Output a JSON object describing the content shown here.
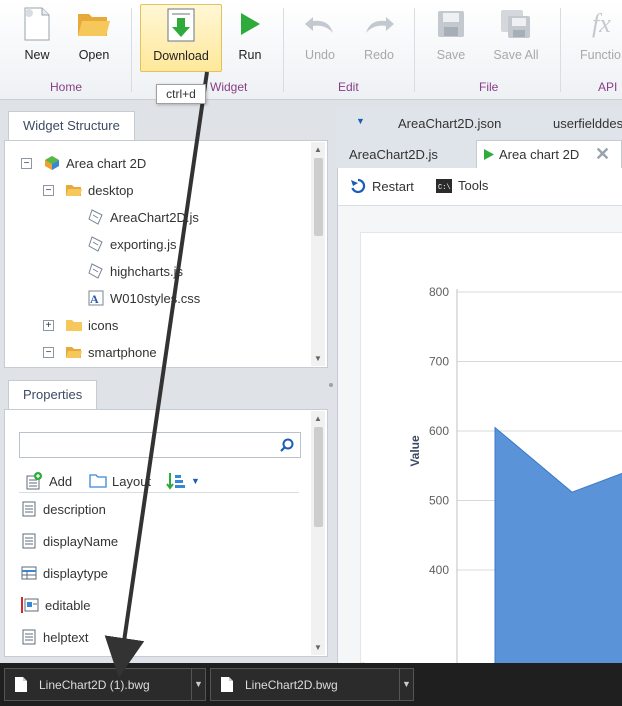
{
  "ribbon": {
    "buttons": {
      "new": "New",
      "open": "Open",
      "download": "Download",
      "run": "Run",
      "undo": "Undo",
      "redo": "Redo",
      "save": "Save",
      "save_all": "Save All",
      "functions": "Functio"
    },
    "groups": {
      "home": "Home",
      "widget": "Widget",
      "edit": "Edit",
      "file": "File",
      "api": "API"
    },
    "tooltip": "ctrl+d"
  },
  "widget_structure": {
    "tab": "Widget Structure",
    "tree": [
      {
        "label": "Area chart 2D",
        "toggle": "−"
      },
      {
        "label": "desktop",
        "toggle": "−"
      },
      {
        "label": "AreaChart2D.js"
      },
      {
        "label": "exporting.js"
      },
      {
        "label": "highcharts.js"
      },
      {
        "label": "W010styles.css"
      },
      {
        "label": "icons",
        "toggle": "+"
      },
      {
        "label": "smartphone",
        "toggle": "−"
      }
    ]
  },
  "properties": {
    "tab": "Properties",
    "search_placeholder": "",
    "toolbar": {
      "add": "Add",
      "layout": "Layout"
    },
    "items": [
      "description",
      "displayName",
      "displaytype",
      "editable",
      "helptext"
    ]
  },
  "editor": {
    "tabs_row1": [
      "AreaChart2D.json",
      "userfielddes"
    ],
    "tabs_row2": [
      "AreaChart2D.js",
      "Area chart 2D"
    ],
    "toolbar": {
      "restart": "Restart",
      "tools": "Tools"
    }
  },
  "chart_data": {
    "type": "area",
    "ylabel": "Value",
    "ylim": [
      300,
      800
    ],
    "yticks": [
      "800",
      "700",
      "600",
      "500",
      "400"
    ],
    "tick_values": [
      800,
      700,
      600,
      500,
      400
    ],
    "points": [
      605,
      512,
      540
    ],
    "color": "#5b93d9"
  },
  "downloads": [
    "LineChart2D (1).bwg",
    "LineChart2D.bwg"
  ],
  "colors": {
    "accent": "#8a3d86",
    "run_green": "#2eab3b",
    "chart_blue": "#5b93d9"
  }
}
